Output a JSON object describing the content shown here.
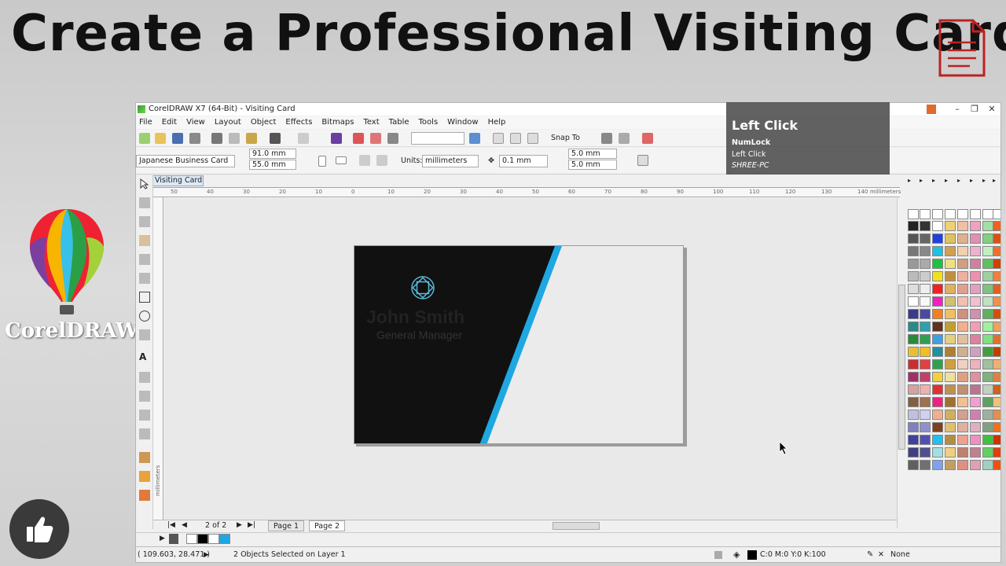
{
  "banner": {
    "title": "Create a Professional Visiting Card",
    "brand": "CorelDRAW"
  },
  "window": {
    "title": "CorelDRAW X7 (64-Bit) - Visiting Card",
    "controls": [
      "–",
      "❐",
      "✕"
    ]
  },
  "menu": [
    "File",
    "Edit",
    "View",
    "Layout",
    "Object",
    "Effects",
    "Bitmaps",
    "Text",
    "Table",
    "Tools",
    "Window",
    "Help"
  ],
  "toolbar": {
    "snap_to": "Snap To"
  },
  "property_bar": {
    "preset": "Japanese Business Card",
    "width": "91.0 mm",
    "height": "55.0 mm",
    "units_label": "Units:",
    "units_value": "millimeters",
    "nudge": "0.1 mm",
    "dup_x": "5.0 mm",
    "dup_y": "5.0 mm"
  },
  "overlay": {
    "action": "Left Click",
    "key": "NumLock",
    "sub": "Left Click",
    "machine": "SHREE-PC"
  },
  "doc_tab": "Visiting Card",
  "ruler": {
    "h_ticks": [
      "50",
      "40",
      "30",
      "20",
      "10",
      "0",
      "10",
      "20",
      "30",
      "40",
      "50",
      "60",
      "70",
      "80",
      "90",
      "100",
      "110",
      "120",
      "130",
      "140"
    ],
    "unit": "millimeters",
    "v_unit": "millimeters"
  },
  "card": {
    "name": "John Smith",
    "title": "General Manager",
    "colors": {
      "dark": "#111111",
      "accent": "#1ea7e1",
      "light": "#ebebeb"
    }
  },
  "pages": {
    "counter": "2 of 2",
    "tabs": [
      "Page 1",
      "Page 2"
    ]
  },
  "status": {
    "coords": "( 109.603, 28.471 )",
    "message": "2 Objects Selected on Layer 1",
    "fill": "C:0 M:0 Y:0 K:100",
    "outline": "None"
  }
}
